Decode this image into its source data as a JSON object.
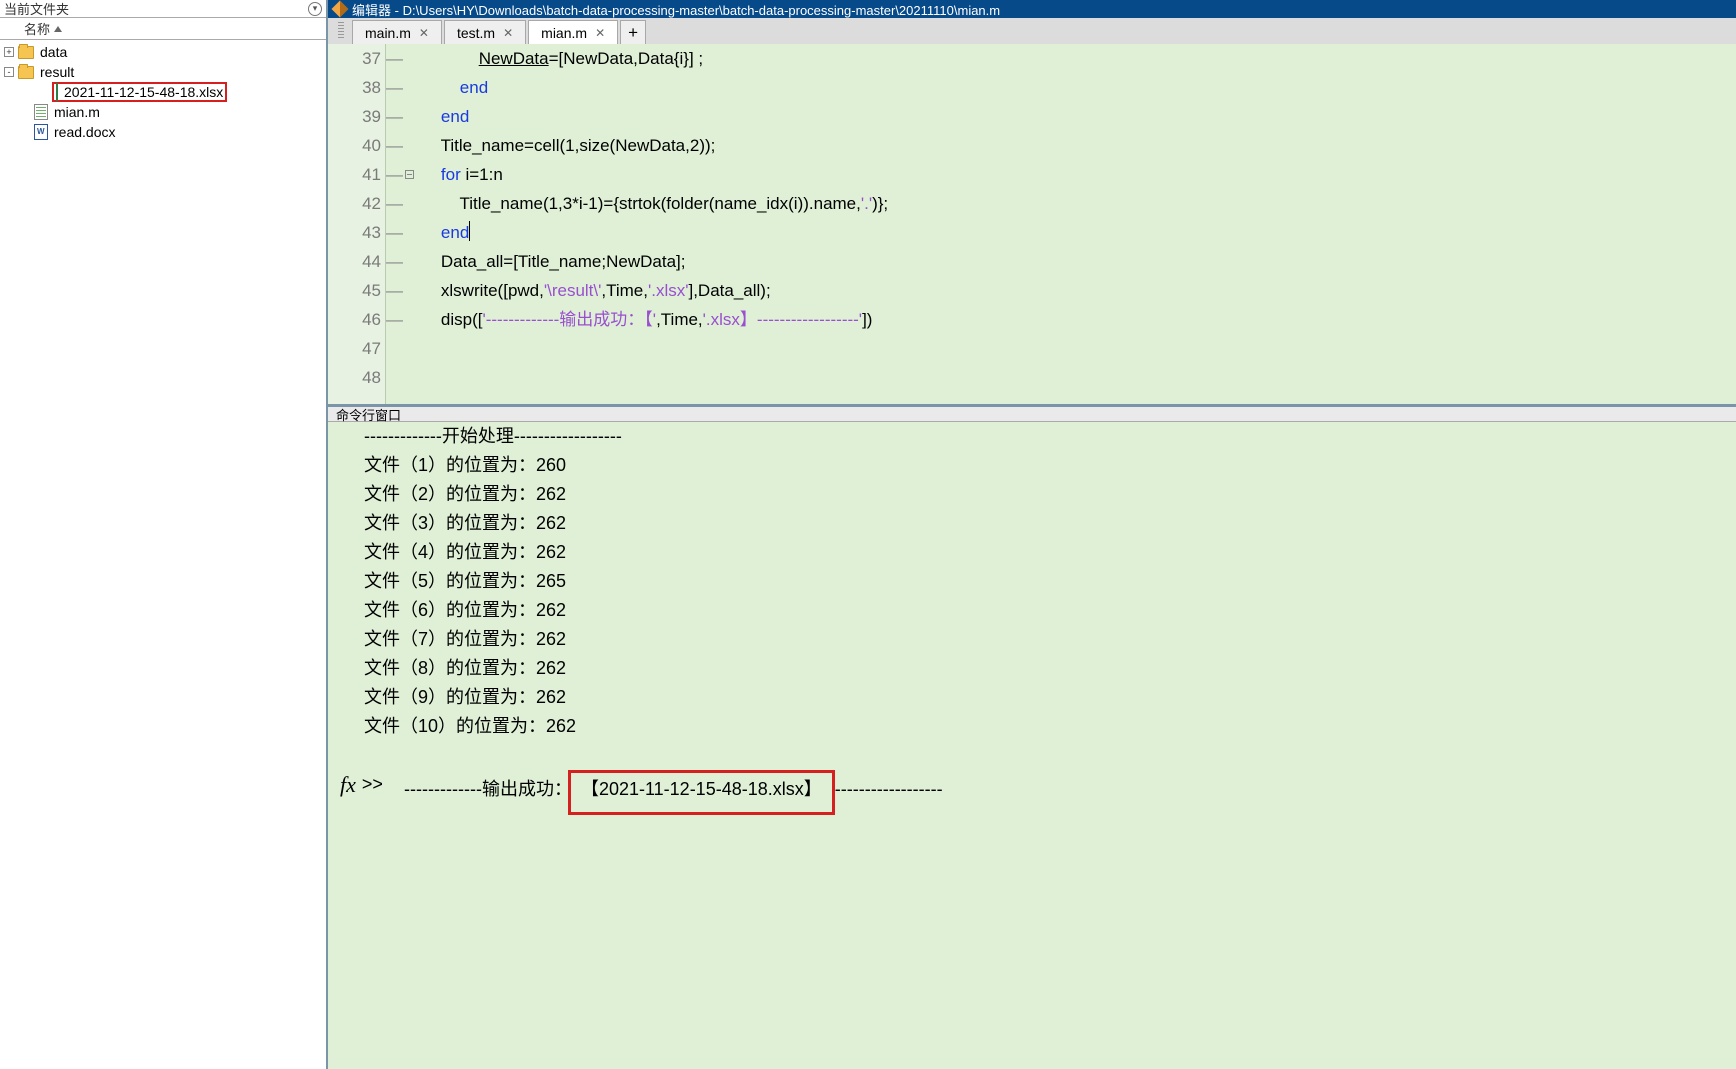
{
  "left": {
    "panel_title": "当前文件夹",
    "col_name": "名称",
    "tree": [
      {
        "type": "folder",
        "name": "data",
        "exp": "+",
        "indent": 0
      },
      {
        "type": "folder",
        "name": "result",
        "exp": "-",
        "indent": 0
      },
      {
        "type": "file",
        "name": "2021-11-12-15-48-18.xlsx",
        "icon": "xlsx",
        "indent": 2,
        "red": true
      },
      {
        "type": "file",
        "name": "mian.m",
        "icon": "green",
        "indent": 1
      },
      {
        "type": "file",
        "name": "read.docx",
        "icon": "word",
        "indent": 1
      }
    ]
  },
  "editor": {
    "title_prefix": "编辑器 - ",
    "path": "D:\\Users\\HY\\Downloads\\batch-data-processing-master\\batch-data-processing-master\\20211110\\mian.m",
    "tabs": [
      {
        "label": "main.m",
        "active": false
      },
      {
        "label": "test.m",
        "active": false
      },
      {
        "label": "mian.m",
        "active": true
      }
    ],
    "lines": [
      {
        "n": 37,
        "dash": "—",
        "fold": "",
        "code": "            NewData=[NewData,Data{i}] ;",
        "underline": "NewData"
      },
      {
        "n": 38,
        "dash": "—",
        "fold": "",
        "code": "        end",
        "kw": [
          "end"
        ]
      },
      {
        "n": 39,
        "dash": "—",
        "fold": "",
        "code": "    end",
        "kw": [
          "end"
        ]
      },
      {
        "n": 40,
        "dash": "—",
        "fold": "",
        "code": "    Title_name=cell(1,size(NewData,2));"
      },
      {
        "n": 41,
        "dash": "—",
        "fold": "box",
        "code": "    for i=1:n",
        "kw": [
          "for"
        ]
      },
      {
        "n": 42,
        "dash": "—",
        "fold": "",
        "code": "        Title_name(1,3*i-1)={strtok(folder(name_idx(i)).name,'.')};",
        "str": [
          "'.'"
        ]
      },
      {
        "n": 43,
        "dash": "—",
        "fold": "",
        "code": "    end",
        "kw": [
          "end"
        ],
        "cursor": true
      },
      {
        "n": 44,
        "dash": "—",
        "fold": "",
        "code": "    Data_all=[Title_name;NewData];"
      },
      {
        "n": 45,
        "dash": "—",
        "fold": "",
        "code": "    xlswrite([pwd,'\\result\\',Time,'.xlsx'],Data_all);",
        "str": [
          "'\\result\\'",
          "'.xlsx'"
        ]
      },
      {
        "n": 46,
        "dash": "—",
        "fold": "",
        "code": "    disp(['-------------输出成功：【',Time,'.xlsx】------------------'])",
        "str": [
          "'-------------输出成功：【'",
          "'.xlsx】------------------'"
        ]
      },
      {
        "n": 47,
        "dash": "",
        "fold": "",
        "code": ""
      },
      {
        "n": 48,
        "dash": "",
        "fold": "",
        "code": ""
      }
    ]
  },
  "cmd": {
    "title": "命令行窗口",
    "prompt": ">>",
    "fx": "fx",
    "lines": [
      "-------------开始处理------------------",
      "文件（1）的位置为：260",
      "文件（2）的位置为：262",
      "文件（3）的位置为：262",
      "文件（4）的位置为：262",
      "文件（5）的位置为：265",
      "文件（6）的位置为：262",
      "文件（7）的位置为：262",
      "文件（8）的位置为：262",
      "文件（9）的位置为：262",
      "文件（10）的位置为：262"
    ],
    "success_prefix": "-------------输出成功：",
    "success_file": "【2021-11-12-15-48-18.xlsx】",
    "success_suffix": "------------------"
  }
}
